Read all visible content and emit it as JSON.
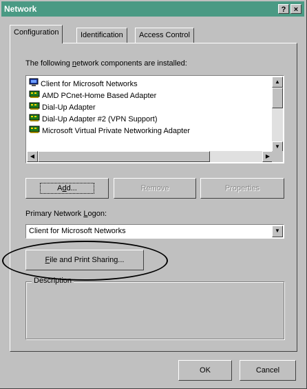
{
  "window": {
    "title": "Network",
    "help_button": "?",
    "close_button": "×"
  },
  "tabs": [
    {
      "label": "Configuration",
      "active": true
    },
    {
      "label": "Identification",
      "active": false
    },
    {
      "label": "Access Control",
      "active": false
    }
  ],
  "components": {
    "heading_pre": "The following ",
    "heading_u": "n",
    "heading_post": "etwork components are installed:",
    "items": [
      {
        "label": "Client for Microsoft Networks",
        "icon": "network-client-icon"
      },
      {
        "label": "AMD PCnet-Home Based Adapter",
        "icon": "network-adapter-icon"
      },
      {
        "label": "Dial-Up Adapter",
        "icon": "network-adapter-icon"
      },
      {
        "label": "Dial-Up Adapter #2 (VPN Support)",
        "icon": "network-adapter-icon"
      },
      {
        "label": "Microsoft Virtual Private Networking Adapter",
        "icon": "network-adapter-icon"
      }
    ]
  },
  "buttons": {
    "add_pre": "A",
    "add_u": "d",
    "add_post": "d...",
    "remove": "Remove",
    "properties": "Properties",
    "file_print_u": "F",
    "file_print_rest": "ile and Print Sharing...",
    "ok": "OK",
    "cancel": "Cancel"
  },
  "logon": {
    "label_pre": "Primary Network ",
    "label_u": "L",
    "label_post": "ogon:",
    "value": "Client for Microsoft Networks"
  },
  "description": {
    "label": "Description"
  },
  "colors": {
    "titlebar": "#4a9a84",
    "face": "#c0c0c0"
  }
}
